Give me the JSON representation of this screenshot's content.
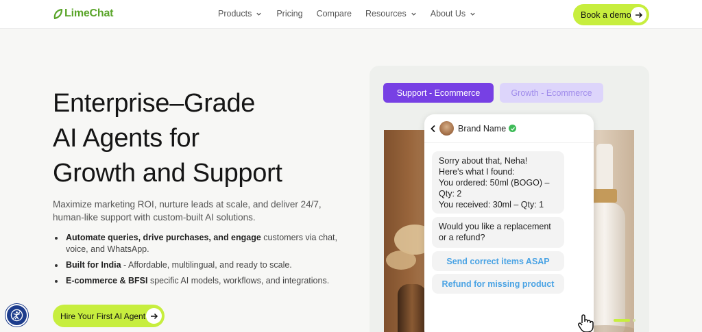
{
  "brand": {
    "name": "LimeChat",
    "accent": "#c7ee3e",
    "logo_color": "#5aa52a",
    "purple": "#7740e4"
  },
  "nav": {
    "items": [
      {
        "label": "Products",
        "has_dropdown": true
      },
      {
        "label": "Pricing",
        "has_dropdown": false
      },
      {
        "label": "Compare",
        "has_dropdown": false
      },
      {
        "label": "Resources",
        "has_dropdown": true
      },
      {
        "label": "About Us",
        "has_dropdown": true
      }
    ],
    "cta_label": "Book a demo"
  },
  "hero": {
    "title_lines": [
      "Enterprise–Grade",
      "AI Agents for",
      "Growth and Support"
    ],
    "subtitle": "Maximize marketing ROI, nurture leads at scale, and deliver 24/7, human-like support with custom-built AI solutions.",
    "bullets": [
      {
        "bold": "Automate queries, drive purchases, and engage",
        "rest": " customers via chat, voice, and WhatsApp."
      },
      {
        "bold": "Built for India",
        "rest": " - Affordable, multilingual, and ready to scale."
      },
      {
        "bold": "E-commerce & BFSI",
        "rest": " specific AI models, workflows, and integrations."
      }
    ],
    "cta_label": "Hire Your First AI Agent"
  },
  "demo": {
    "tabs": [
      {
        "label": "Support - Ecommerce",
        "active": true
      },
      {
        "label": "Growth - Ecommerce",
        "active": false
      }
    ],
    "chat": {
      "brand_name": "Brand Name",
      "messages": [
        {
          "lines": [
            "Sorry about that, Neha!",
            "Here's what I found:",
            "You ordered: 50ml (BOGO) –",
            "Qty: 2",
            "You received: 30ml – Qty: 1"
          ]
        },
        {
          "lines": [
            "Would you like a replacement",
            "or a refund?"
          ]
        }
      ],
      "quick_replies": [
        "Send correct items ASAP",
        "Refund for missing product"
      ]
    }
  },
  "icons": {
    "chevron": "chevron-down-icon",
    "arrow": "arrow-right-icon",
    "accessibility": "accessibility-icon",
    "back": "chevron-left-icon",
    "verified": "verified-check-icon",
    "cursor": "hand-pointer-icon"
  }
}
